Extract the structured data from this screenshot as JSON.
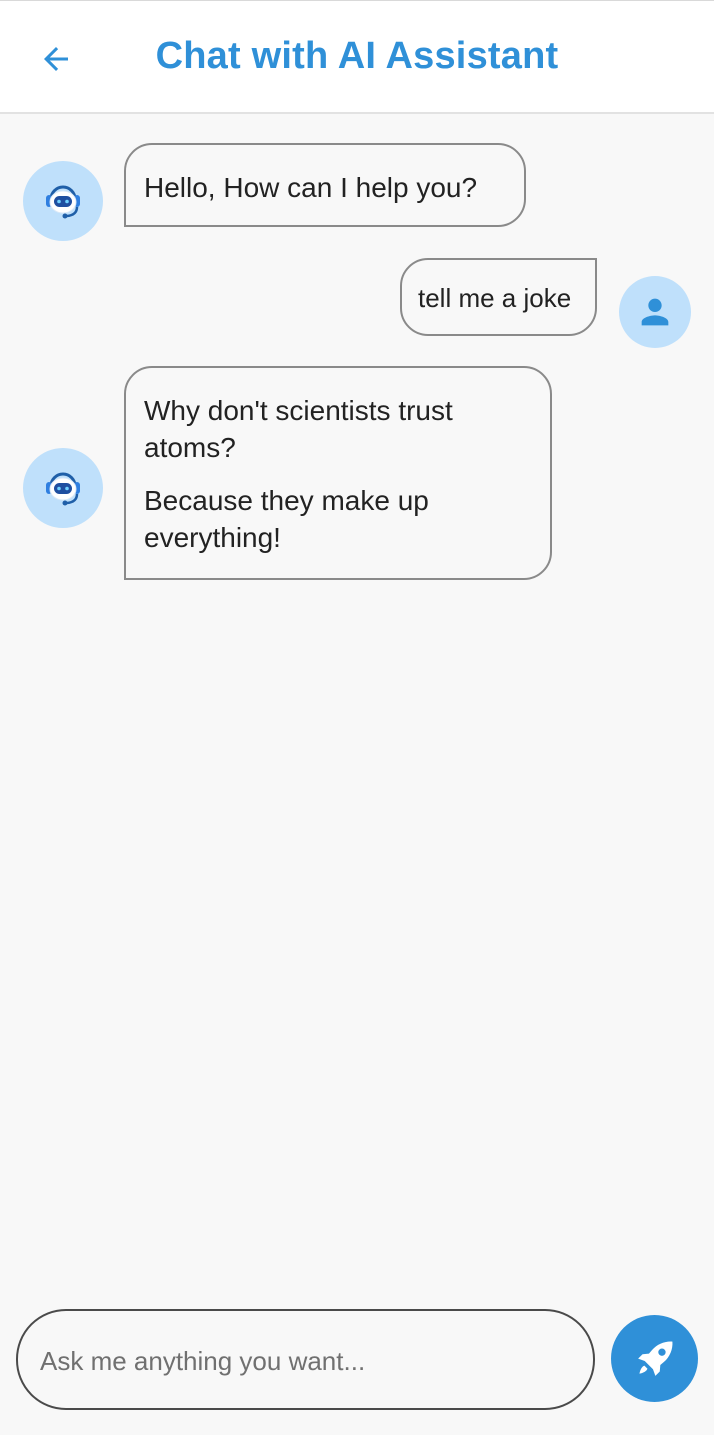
{
  "header": {
    "back_icon": "arrow-left-icon",
    "title": "Chat with AI Assistant"
  },
  "messages": [
    {
      "sender": "bot",
      "avatar_icon": "robot-icon",
      "paragraphs": [
        "Hello, How can I help you?"
      ]
    },
    {
      "sender": "user",
      "avatar_icon": "person-icon",
      "paragraphs": [
        "tell me a joke"
      ]
    },
    {
      "sender": "bot",
      "avatar_icon": "robot-icon",
      "paragraphs": [
        "Why don't scientists trust atoms?",
        "Because they make up everything!"
      ]
    }
  ],
  "composer": {
    "value": "",
    "placeholder": "Ask me anything you want...",
    "send_icon": "rocket-icon"
  },
  "colors": {
    "accent": "#2f90d8",
    "avatar_bg": "#bfe0fb",
    "background": "#f8f8f8",
    "bubble_border": "#8a8a8a"
  }
}
